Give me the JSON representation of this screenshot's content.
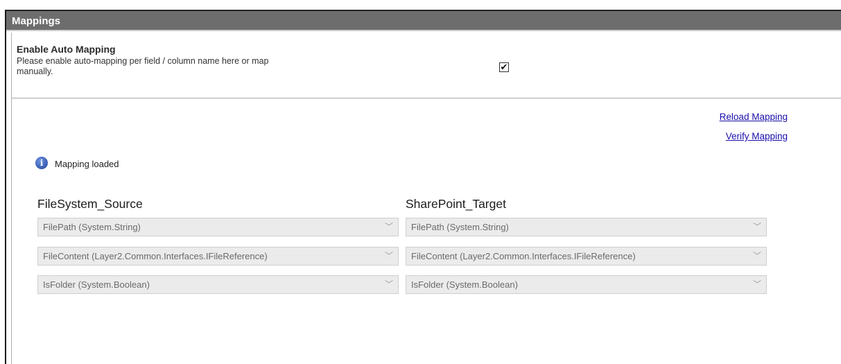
{
  "header": {
    "title": "Mappings"
  },
  "auto_mapping": {
    "title": "Enable Auto Mapping",
    "description": "Please enable auto-mapping per field / column name here or map manually.",
    "checked": true,
    "check_glyph": "✔"
  },
  "links": {
    "reload": "Reload Mapping",
    "verify": "Verify Mapping"
  },
  "status": {
    "icon": "info-icon",
    "icon_glyph": "i",
    "text": "Mapping loaded"
  },
  "columns": {
    "source": "FileSystem_Source",
    "target": "SharePoint_Target"
  },
  "chevron": "﹀",
  "rows": [
    {
      "source": "FilePath (System.String)",
      "target": "FilePath (System.String)"
    },
    {
      "source": "FileContent (Layer2.Common.Interfaces.IFileReference)",
      "target": "FileContent (Layer2.Common.Interfaces.IFileReference)"
    },
    {
      "source": "IsFolder (System.Boolean)",
      "target": "IsFolder (System.Boolean)"
    }
  ]
}
